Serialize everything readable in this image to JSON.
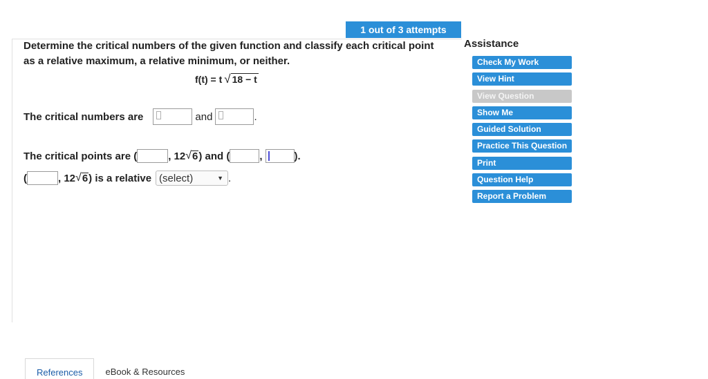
{
  "attempts": "1 out of 3 attempts",
  "question": {
    "prompt": "Determine the critical numbers of the given function and classify each critical point as a relative maximum, a relative minimum, or neither.",
    "function_lhs": "f(t) = t",
    "function_radicand": "18 − t"
  },
  "critical_numbers": {
    "label": "The critical numbers are",
    "and": "and",
    "period": "."
  },
  "critical_points": {
    "label": "The critical points are (",
    "coef_text": ", 12",
    "radicand": "6",
    "close_and": ") and (",
    "comma": ",",
    "close": ").",
    "line2_open": "(",
    "line2_coef": ", 12",
    "line2_radicand": "6",
    "line2_text": ") is a relative",
    "select_value": "(select)",
    "line2_end": "."
  },
  "assistance": {
    "title": "Assistance",
    "buttons": [
      {
        "label": "Check My Work"
      },
      {
        "label": "View Hint"
      },
      {
        "label": "View Question"
      },
      {
        "label": "Show Me"
      },
      {
        "label": "Guided Solution"
      },
      {
        "label": "Practice This Question"
      },
      {
        "label": "Print"
      },
      {
        "label": "Question Help"
      },
      {
        "label": "Report a Problem"
      }
    ]
  },
  "tabs": [
    {
      "label": "References"
    },
    {
      "label": "eBook & Resources"
    }
  ],
  "colors": {
    "accent": "#2b8fd8",
    "disabled": "#c8c8c8"
  }
}
